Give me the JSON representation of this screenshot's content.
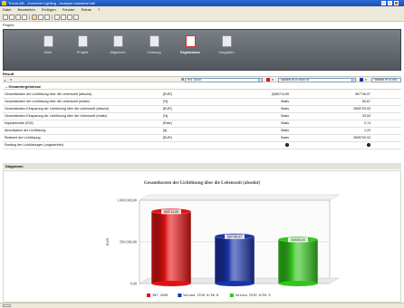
{
  "window": {
    "title": "TrecoLAB - Zumtobel Lighting - Analysis Industrial hall"
  },
  "menu": {
    "items": [
      "Datei",
      "Bearbeiten",
      "Einfügen",
      "Fenster",
      "Extras",
      "?"
    ]
  },
  "project": {
    "label": "Project"
  },
  "steps": [
    {
      "label": "Ziele",
      "icon": "goal-icon"
    },
    {
      "label": "Projekt",
      "icon": "project-icon"
    },
    {
      "label": "Allgemein",
      "icon": "general-icon"
    },
    {
      "label": "Leistung",
      "icon": "performance-icon"
    },
    {
      "label": "Ergebnisse",
      "icon": "results-icon",
      "active": true
    },
    {
      "label": "Vorgaben",
      "icon": "settings-icon"
    }
  ],
  "result": {
    "label": "Result"
  },
  "selectors": {
    "a": "INT 4200°",
    "b": "Valuea IP20 6/50 lo°",
    "c": "Valuea IP20 6/5"
  },
  "colors": {
    "red": "#e01313",
    "blue": "#1b33a8",
    "green": "#33c41e"
  },
  "section": {
    "title": "Gesamtergebnisse"
  },
  "table": {
    "rows": [
      {
        "label": "Gesamtkosten der Lichtlösung über die Lebenszeit (absolut)",
        "unit": "[EUR]",
        "a": "(5)56714,89",
        "b": "567746,97"
      },
      {
        "label": "Gesamtkosten der Lichtlösung über die Lebenszeit (relativ)",
        "unit": "[%]",
        "a": "Basis",
        "b": "65,67"
      },
      {
        "label": "Gesamtkosten-Einsparung der Lichtlösung über die Lebenszeit (absolut)",
        "unit": "[EUR]",
        "a": "Basis",
        "b": "2695709,93"
      },
      {
        "label": "Gesamtkosten-Einsparung der Lichtlösung über die Lebenszeit (relativ)",
        "unit": "[%]",
        "a": "Basis",
        "b": "33,53"
      },
      {
        "label": "Kapitalrendite (ROI)",
        "unit": "[Rate]",
        "a": "Basis",
        "b": "0,74"
      },
      {
        "label": "Amortisation der Lichtlösung",
        "unit": "[a]",
        "a": "Basis",
        "b": "1,20"
      },
      {
        "label": "Restwert der Lichtlösung",
        "unit": "[EUR]",
        "a": "Basis",
        "b": "2695709,93"
      },
      {
        "label": "Ranking der Lichtlösungen (ungewichtet)",
        "unit": "",
        "a": "info",
        "b": "info"
      }
    ]
  },
  "diagram": {
    "label": "Diagramm"
  },
  "chart_data": {
    "type": "bar",
    "title": "Gesamtkosten der Lichtlösung über die Lebenszeit (absolut)",
    "ylabel": "EUR",
    "yticks": [
      "1.000.000,00",
      "500.000,00",
      "0,00"
    ],
    "ylim": [
      0,
      1000000
    ],
    "series": [
      {
        "name": "INT 4200",
        "value": 866714.89,
        "label": "866714,89",
        "color": "#e01313"
      },
      {
        "name": "Valuea IP20 6/50 N",
        "value": 567746.97,
        "label": "567746,97",
        "color": "#1b33a8"
      },
      {
        "name": "Valuea IP20 6/50 D",
        "value": 530000,
        "label": "530000,00",
        "color": "#33c41e"
      }
    ]
  }
}
